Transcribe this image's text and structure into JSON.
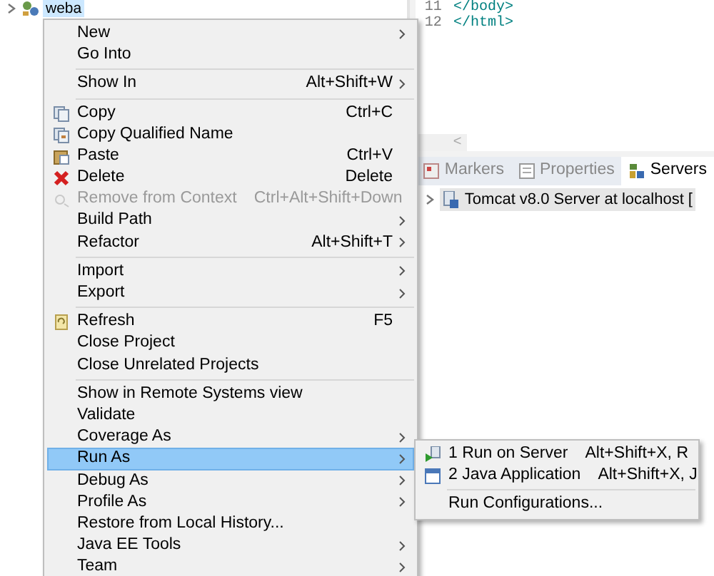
{
  "explorer": {
    "items": [
      {
        "label": "weba",
        "expanded": false,
        "selected": true
      }
    ]
  },
  "editor": {
    "lines": [
      {
        "number": "11",
        "code": "</body>"
      },
      {
        "number": "12",
        "code": "</html>"
      }
    ],
    "scroll_left": "<"
  },
  "bottom_panel": {
    "tabs": [
      {
        "label": "Markers",
        "selected": false
      },
      {
        "label": "Properties",
        "selected": false
      },
      {
        "label": "Servers",
        "selected": true
      }
    ],
    "tree": [
      {
        "label": "Tomcat v8.0 Server at localhost [",
        "expanded": false,
        "selected": true
      }
    ]
  },
  "context_menu": {
    "items": [
      {
        "kind": "item",
        "label": "New",
        "submenu": true,
        "disabled": false,
        "selected": false
      },
      {
        "kind": "item",
        "label": "Go Into",
        "submenu": false,
        "disabled": false,
        "selected": false
      },
      {
        "kind": "separator"
      },
      {
        "kind": "item",
        "label": "Show In",
        "shortcut": "Alt+Shift+W",
        "submenu": true,
        "disabled": false,
        "selected": false
      },
      {
        "kind": "separator"
      },
      {
        "kind": "item",
        "label": "Copy",
        "shortcut": "Ctrl+C",
        "submenu": false,
        "disabled": false,
        "selected": false
      },
      {
        "kind": "item",
        "label": "Copy Qualified Name",
        "submenu": false,
        "disabled": false,
        "selected": false
      },
      {
        "kind": "item",
        "label": "Paste",
        "shortcut": "Ctrl+V",
        "submenu": false,
        "disabled": false,
        "selected": false
      },
      {
        "kind": "item",
        "label": "Delete",
        "shortcut": "Delete",
        "submenu": false,
        "disabled": false,
        "selected": false
      },
      {
        "kind": "item",
        "label": "Remove from Context",
        "shortcut": "Ctrl+Alt+Shift+Down",
        "submenu": false,
        "disabled": true,
        "selected": false
      },
      {
        "kind": "item",
        "label": "Build Path",
        "submenu": true,
        "disabled": false,
        "selected": false
      },
      {
        "kind": "item",
        "label": "Refactor",
        "shortcut": "Alt+Shift+T",
        "submenu": true,
        "disabled": false,
        "selected": false
      },
      {
        "kind": "separator"
      },
      {
        "kind": "item",
        "label": "Import",
        "submenu": true,
        "disabled": false,
        "selected": false
      },
      {
        "kind": "item",
        "label": "Export",
        "submenu": true,
        "disabled": false,
        "selected": false
      },
      {
        "kind": "separator"
      },
      {
        "kind": "item",
        "label": "Refresh",
        "shortcut": "F5",
        "submenu": false,
        "disabled": false,
        "selected": false
      },
      {
        "kind": "item",
        "label": "Close Project",
        "submenu": false,
        "disabled": false,
        "selected": false
      },
      {
        "kind": "item",
        "label": "Close Unrelated Projects",
        "submenu": false,
        "disabled": false,
        "selected": false
      },
      {
        "kind": "separator"
      },
      {
        "kind": "item",
        "label": "Show in Remote Systems view",
        "submenu": false,
        "disabled": false,
        "selected": false
      },
      {
        "kind": "item",
        "label": "Validate",
        "submenu": false,
        "disabled": false,
        "selected": false
      },
      {
        "kind": "item",
        "label": "Coverage As",
        "submenu": true,
        "disabled": false,
        "selected": false
      },
      {
        "kind": "item",
        "label": "Run As",
        "submenu": true,
        "disabled": false,
        "selected": true
      },
      {
        "kind": "item",
        "label": "Debug As",
        "submenu": true,
        "disabled": false,
        "selected": false
      },
      {
        "kind": "item",
        "label": "Profile As",
        "submenu": true,
        "disabled": false,
        "selected": false
      },
      {
        "kind": "item",
        "label": "Restore from Local History...",
        "submenu": false,
        "disabled": false,
        "selected": false
      },
      {
        "kind": "item",
        "label": "Java EE Tools",
        "submenu": true,
        "disabled": false,
        "selected": false
      },
      {
        "kind": "item",
        "label": "Team",
        "submenu": true,
        "disabled": false,
        "selected": false
      }
    ]
  },
  "submenu": {
    "items": [
      {
        "kind": "item",
        "label": "1 Run on Server",
        "shortcut": "Alt+Shift+X, R",
        "submenu": false,
        "disabled": false,
        "selected": false
      },
      {
        "kind": "item",
        "label": "2 Java Application",
        "shortcut": "Alt+Shift+X, J",
        "submenu": false,
        "disabled": false,
        "selected": false
      },
      {
        "kind": "separator"
      },
      {
        "kind": "item",
        "label": "Run Configurations...",
        "submenu": false,
        "disabled": false,
        "selected": false
      }
    ]
  }
}
